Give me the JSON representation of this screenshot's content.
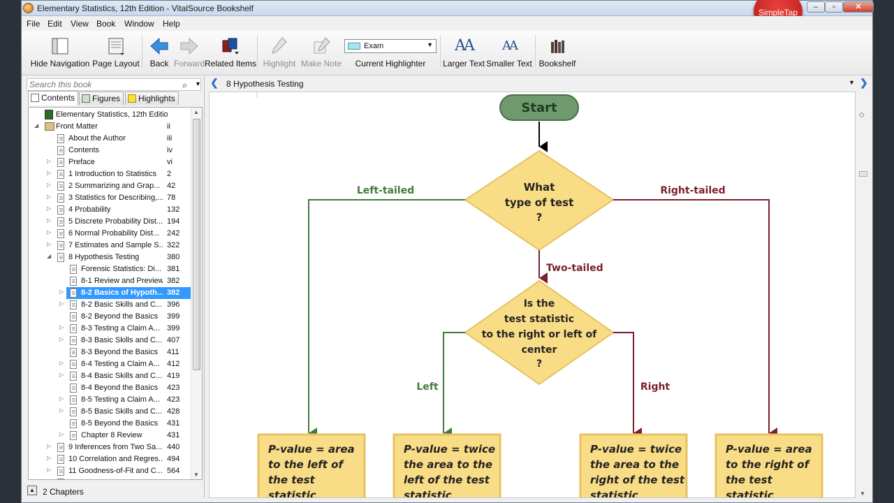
{
  "window": {
    "title": "Elementary Statistics, 12th Edition - VitalSource Bookshelf",
    "overlay_badge": "SimpleTap",
    "controls": {
      "minimize": "–",
      "maximize": "▫",
      "close": "✕"
    }
  },
  "menu": [
    "File",
    "Edit",
    "View",
    "Book",
    "Window",
    "Help"
  ],
  "toolbar": {
    "hide_navigation": "Hide Navigation",
    "page_layout": "Page Layout",
    "back": "Back",
    "forward": "Forward",
    "related_items": "Related Items",
    "highlight": "Highlight",
    "make_note": "Make Note",
    "current_highlighter_label": "Current Highlighter",
    "current_highlighter_value": "Exam",
    "larger_text": "Larger Text",
    "smaller_text": "Smaller Text",
    "bookshelf": "Bookshelf",
    "larger_text_glyph": "AA",
    "smaller_text_glyph": "AA"
  },
  "sidebar": {
    "search_placeholder": "Search this book",
    "tabs": [
      "Contents",
      "Figures",
      "Highlights"
    ],
    "active_tab": "Contents",
    "footer": "2 Chapters",
    "toc": [
      {
        "title": "Elementary Statistics, 12th Edition",
        "page": "",
        "level": 0,
        "icon": "book",
        "expander": ""
      },
      {
        "title": "Front Matter",
        "page": "ii",
        "level": 0,
        "icon": "folder",
        "expander": "expanded"
      },
      {
        "title": "About the Author",
        "page": "iii",
        "level": 1,
        "icon": "page",
        "expander": ""
      },
      {
        "title": "Contents",
        "page": "iv",
        "level": 1,
        "icon": "page",
        "expander": ""
      },
      {
        "title": "Preface",
        "page": "vi",
        "level": 1,
        "icon": "page",
        "expander": "collapsed"
      },
      {
        "title": "1 Introduction to Statistics",
        "page": "2",
        "level": 1,
        "icon": "page",
        "expander": "collapsed"
      },
      {
        "title": "2 Summarizing and Grap...",
        "page": "42",
        "level": 1,
        "icon": "page",
        "expander": "collapsed"
      },
      {
        "title": "3 Statistics for Describing,...",
        "page": "78",
        "level": 1,
        "icon": "page",
        "expander": "collapsed"
      },
      {
        "title": "4 Probability",
        "page": "132",
        "level": 1,
        "icon": "page",
        "expander": "collapsed"
      },
      {
        "title": "5 Discrete Probability Dist...",
        "page": "194",
        "level": 1,
        "icon": "page",
        "expander": "collapsed"
      },
      {
        "title": "6 Normal Probability Dist...",
        "page": "242",
        "level": 1,
        "icon": "page",
        "expander": "collapsed"
      },
      {
        "title": "7 Estimates and Sample S...",
        "page": "322",
        "level": 1,
        "icon": "page",
        "expander": "collapsed"
      },
      {
        "title": "8 Hypothesis Testing",
        "page": "380",
        "level": 1,
        "icon": "page",
        "expander": "expanded"
      },
      {
        "title": "Forensic Statistics: Di...",
        "page": "381",
        "level": 2,
        "icon": "page",
        "expander": ""
      },
      {
        "title": "8-1 Review and Preview",
        "page": "382",
        "level": 2,
        "icon": "page",
        "expander": ""
      },
      {
        "title": "8-2 Basics of Hypoth...",
        "page": "382",
        "level": 2,
        "icon": "page",
        "expander": "collapsed",
        "selected": true
      },
      {
        "title": "8-2 Basic Skills and C...",
        "page": "396",
        "level": 2,
        "icon": "page",
        "expander": "collapsed"
      },
      {
        "title": "8-2 Beyond the Basics",
        "page": "399",
        "level": 2,
        "icon": "page",
        "expander": ""
      },
      {
        "title": "8-3 Testing a Claim A...",
        "page": "399",
        "level": 2,
        "icon": "page",
        "expander": "collapsed"
      },
      {
        "title": "8-3 Basic Skills and C...",
        "page": "407",
        "level": 2,
        "icon": "page",
        "expander": "collapsed"
      },
      {
        "title": "8-3 Beyond the Basics",
        "page": "411",
        "level": 2,
        "icon": "page",
        "expander": ""
      },
      {
        "title": "8-4 Testing a Claim A...",
        "page": "412",
        "level": 2,
        "icon": "page",
        "expander": "collapsed"
      },
      {
        "title": "8-4 Basic Skills and C...",
        "page": "419",
        "level": 2,
        "icon": "page",
        "expander": "collapsed"
      },
      {
        "title": "8-4 Beyond the Basics",
        "page": "423",
        "level": 2,
        "icon": "page",
        "expander": ""
      },
      {
        "title": "8-5 Testing a Claim A...",
        "page": "423",
        "level": 2,
        "icon": "page",
        "expander": "collapsed"
      },
      {
        "title": "8-5 Basic Skills and C...",
        "page": "428",
        "level": 2,
        "icon": "page",
        "expander": "collapsed"
      },
      {
        "title": "8-5 Beyond the Basics",
        "page": "431",
        "level": 2,
        "icon": "page",
        "expander": ""
      },
      {
        "title": "Chapter 8 Review",
        "page": "431",
        "level": 2,
        "icon": "page",
        "expander": "collapsed"
      },
      {
        "title": "9 Inferences from Two Sa...",
        "page": "440",
        "level": 1,
        "icon": "page",
        "expander": "collapsed"
      },
      {
        "title": "10 Correlation and Regres...",
        "page": "494",
        "level": 1,
        "icon": "page",
        "expander": "collapsed"
      },
      {
        "title": "11 Goodness-of-Fit and C...",
        "page": "564",
        "level": 1,
        "icon": "page",
        "expander": "collapsed"
      },
      {
        "title": "12 Analysis of Variance",
        "page": "598",
        "level": 1,
        "icon": "page",
        "expander": "collapsed"
      }
    ]
  },
  "content": {
    "section_title": "8 Hypothesis Testing",
    "flowchart": {
      "start": "Start",
      "question1": [
        "What",
        "type of test",
        "?"
      ],
      "left_tailed": "Left-tailed",
      "right_tailed": "Right-tailed",
      "two_tailed": "Two-tailed",
      "question2": [
        "Is the",
        "test statistic",
        "to the right or left of",
        "center",
        "?"
      ],
      "left": "Left",
      "right": "Right",
      "boxes": [
        [
          "P-value = area",
          "to the left of",
          "the test",
          "statistic"
        ],
        [
          "P-value = twice",
          "the area to the",
          "left of the test",
          "statistic"
        ],
        [
          "P-value = twice",
          "the area to the",
          "right of the test",
          "statistic"
        ],
        [
          "P-value = area",
          "to the right of",
          "the test",
          "statistic"
        ]
      ]
    }
  },
  "colors": {
    "start_fill": "#7aa87a",
    "start_text": "#2b4a2b",
    "diamond_fill": "#fbe08c",
    "box_fill": "#fbe08c",
    "left_path": "#3f7a3b",
    "right_path": "#7a1f2c",
    "selected_row": "#3399ff"
  }
}
